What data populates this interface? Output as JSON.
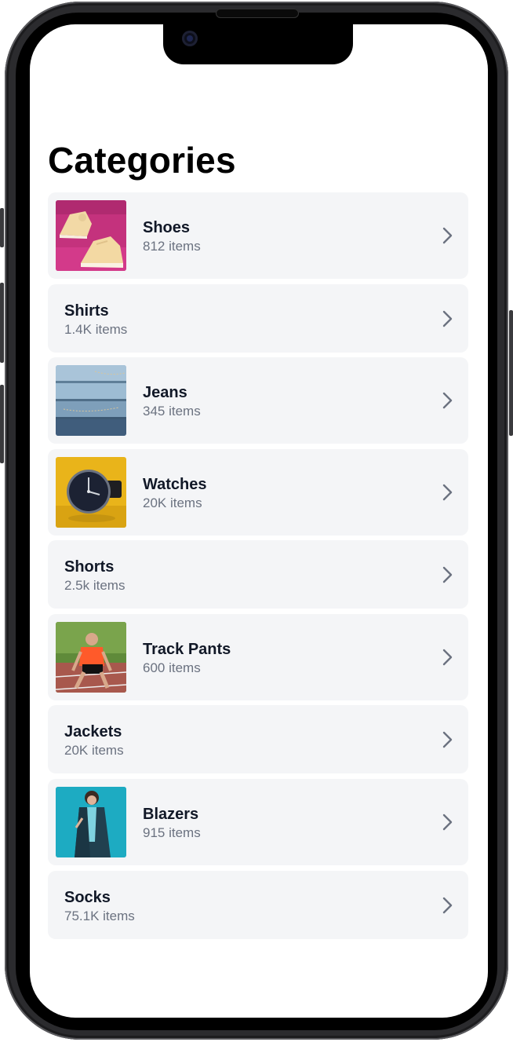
{
  "page": {
    "title": "Categories"
  },
  "categories": [
    {
      "name": "Shoes",
      "count": "812 items",
      "image": "sneakers-photo"
    },
    {
      "name": "Shirts",
      "count": "1.4K items",
      "image": null
    },
    {
      "name": "Jeans",
      "count": "345 items",
      "image": "folded-jeans-photo"
    },
    {
      "name": "Watches",
      "count": "20K items",
      "image": "wristwatch-photo"
    },
    {
      "name": "Shorts",
      "count": "2.5k items",
      "image": null
    },
    {
      "name": "Track Pants",
      "count": "600 items",
      "image": "runner-photo"
    },
    {
      "name": "Jackets",
      "count": "20K items",
      "image": null
    },
    {
      "name": "Blazers",
      "count": "915 items",
      "image": "blazer-model-photo"
    },
    {
      "name": "Socks",
      "count": "75.1K items",
      "image": null
    }
  ],
  "icons": {
    "row_action": "chevron-right-icon"
  },
  "colors": {
    "card_bg": "#f4f5f7",
    "title": "#000000",
    "name": "#111827",
    "count": "#6b7280",
    "chevron": "#6b7280"
  }
}
